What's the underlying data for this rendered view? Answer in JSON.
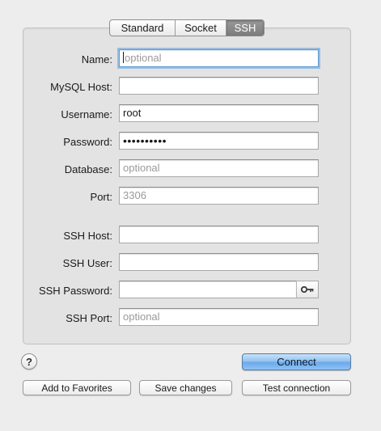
{
  "tabs": {
    "standard": "Standard",
    "socket": "Socket",
    "ssh": "SSH",
    "active": "SSH"
  },
  "form": {
    "name": {
      "label": "Name:",
      "value": "",
      "placeholder": "optional"
    },
    "mysql_host": {
      "label": "MySQL Host:",
      "value": ""
    },
    "username": {
      "label": "Username:",
      "value": "root"
    },
    "password": {
      "label": "Password:",
      "value": "••••••••••"
    },
    "database": {
      "label": "Database:",
      "value": "",
      "placeholder": "optional"
    },
    "port": {
      "label": "Port:",
      "value": "",
      "placeholder": "3306"
    },
    "ssh_host": {
      "label": "SSH Host:",
      "value": ""
    },
    "ssh_user": {
      "label": "SSH User:",
      "value": ""
    },
    "ssh_password": {
      "label": "SSH Password:",
      "value": ""
    },
    "ssh_port": {
      "label": "SSH Port:",
      "value": "",
      "placeholder": "optional"
    }
  },
  "buttons": {
    "help": "?",
    "connect": "Connect",
    "add_to_favorites": "Add to Favorites",
    "save_changes": "Save changes",
    "test_connection": "Test connection"
  },
  "icons": {
    "key": "key-icon",
    "help": "question-mark-icon"
  },
  "colors": {
    "window_background": "#ededed",
    "group_background": "#e3e3e3",
    "focus_ring": "#5d9ede",
    "connect_button": "#8cc2f6",
    "selected_tab": "#8a8a8a"
  }
}
